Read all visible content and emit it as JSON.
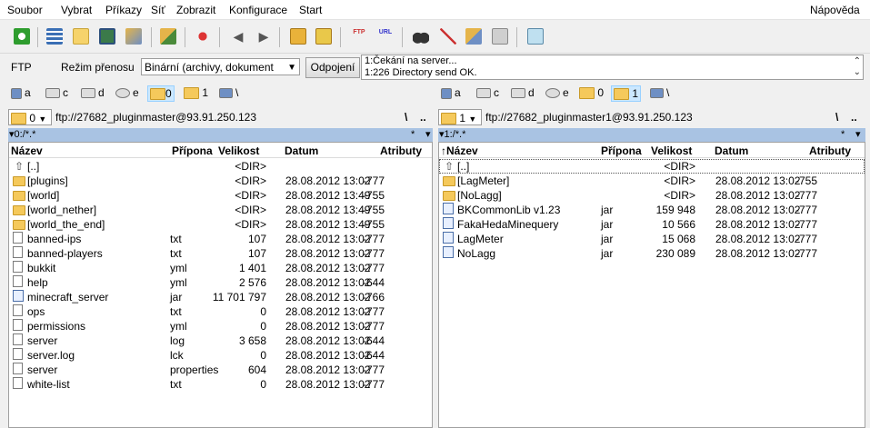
{
  "menu": {
    "items": [
      "Soubor",
      "Vybrat",
      "Příkazy",
      "Síť",
      "Zobrazit",
      "Konfigurace",
      "Start"
    ],
    "help": "Nápověda"
  },
  "ftpbar": {
    "ftp_label": "FTP",
    "mode_label": "Režim přenosu",
    "mode_value": "Binární (archivy, dokument",
    "disconnect_label": "Odpojení",
    "log_lines": [
      "1:Čekání na server...",
      "1:226 Directory send OK."
    ]
  },
  "left": {
    "drives": [
      "a",
      "c",
      "d",
      "e",
      "0",
      "1",
      "\\"
    ],
    "path_combo": "0",
    "path": "ftp://27682_pluginmaster@93.91.250.123",
    "filter": "▾0:/*.*",
    "nav_back": "\\",
    "nav_up": "..",
    "star": "*",
    "filter_arrow": "▾",
    "headers": {
      "name": "Název",
      "ext": "Přípona",
      "size": "Velikost",
      "date": "Datum",
      "attr": "Atributy"
    },
    "rows": [
      {
        "icon": "up",
        "name": "[..]",
        "ext": "",
        "size": "<DIR>",
        "date": "",
        "attr": ""
      },
      {
        "icon": "folder",
        "name": "[plugins]",
        "ext": "",
        "size": "<DIR>",
        "date": "28.08.2012 13:02",
        "attr": "-777"
      },
      {
        "icon": "folder",
        "name": "[world]",
        "ext": "",
        "size": "<DIR>",
        "date": "28.08.2012 13:49",
        "attr": "-755"
      },
      {
        "icon": "folder",
        "name": "[world_nether]",
        "ext": "",
        "size": "<DIR>",
        "date": "28.08.2012 13:49",
        "attr": "-755"
      },
      {
        "icon": "folder",
        "name": "[world_the_end]",
        "ext": "",
        "size": "<DIR>",
        "date": "28.08.2012 13:49",
        "attr": "-755"
      },
      {
        "icon": "file",
        "name": "banned-ips",
        "ext": "txt",
        "size": "107",
        "date": "28.08.2012 13:02",
        "attr": "-777"
      },
      {
        "icon": "file",
        "name": "banned-players",
        "ext": "txt",
        "size": "107",
        "date": "28.08.2012 13:02",
        "attr": "-777"
      },
      {
        "icon": "file",
        "name": "bukkit",
        "ext": "yml",
        "size": "1 401",
        "date": "28.08.2012 13:02",
        "attr": "-777"
      },
      {
        "icon": "file",
        "name": "help",
        "ext": "yml",
        "size": "2 576",
        "date": "28.08.2012 13:02",
        "attr": "-644"
      },
      {
        "icon": "jar",
        "name": "minecraft_server",
        "ext": "jar",
        "size": "11 701 797",
        "date": "28.08.2012 13:02",
        "attr": "-766"
      },
      {
        "icon": "file",
        "name": "ops",
        "ext": "txt",
        "size": "0",
        "date": "28.08.2012 13:02",
        "attr": "-777"
      },
      {
        "icon": "file",
        "name": "permissions",
        "ext": "yml",
        "size": "0",
        "date": "28.08.2012 13:02",
        "attr": "-777"
      },
      {
        "icon": "file",
        "name": "server",
        "ext": "log",
        "size": "3 658",
        "date": "28.08.2012 13:02",
        "attr": "-644"
      },
      {
        "icon": "file",
        "name": "server.log",
        "ext": "lck",
        "size": "0",
        "date": "28.08.2012 13:02",
        "attr": "-644"
      },
      {
        "icon": "file",
        "name": "server",
        "ext": "properties",
        "size": "604",
        "date": "28.08.2012 13:02",
        "attr": "-777"
      },
      {
        "icon": "file",
        "name": "white-list",
        "ext": "txt",
        "size": "0",
        "date": "28.08.2012 13:02",
        "attr": "-777"
      }
    ]
  },
  "right": {
    "drives": [
      "a",
      "c",
      "d",
      "e",
      "0",
      "1",
      "\\"
    ],
    "path_combo": "1",
    "path": "ftp://27682_pluginmaster1@93.91.250.123",
    "filter": "▾1:/*.*",
    "nav_back": "\\",
    "nav_up": "..",
    "star": "*",
    "filter_arrow": "▾",
    "headers": {
      "name": "↑Název",
      "ext": "Přípona",
      "size": "Velikost",
      "date": "Datum",
      "attr": "Atributy"
    },
    "rows": [
      {
        "icon": "up",
        "name": "[..]",
        "ext": "",
        "size": "<DIR>",
        "date": "",
        "attr": ""
      },
      {
        "icon": "folder",
        "name": "[LagMeter]",
        "ext": "",
        "size": "<DIR>",
        "date": "28.08.2012 13:02",
        "attr": "-755"
      },
      {
        "icon": "folder",
        "name": "[NoLagg]",
        "ext": "",
        "size": "<DIR>",
        "date": "28.08.2012 13:02",
        "attr": "-777"
      },
      {
        "icon": "jar",
        "name": "BKCommonLib v1.23",
        "ext": "jar",
        "size": "159 948",
        "date": "28.08.2012 13:02",
        "attr": "-777"
      },
      {
        "icon": "jar",
        "name": "FakaHedaMinequery",
        "ext": "jar",
        "size": "10 566",
        "date": "28.08.2012 13:02",
        "attr": "-777"
      },
      {
        "icon": "jar",
        "name": "LagMeter",
        "ext": "jar",
        "size": "15 068",
        "date": "28.08.2012 13:02",
        "attr": "-777"
      },
      {
        "icon": "jar",
        "name": "NoLagg",
        "ext": "jar",
        "size": "230 089",
        "date": "28.08.2012 13:02",
        "attr": "-777"
      }
    ]
  },
  "colors": {
    "filterbar": "#a9c3e3",
    "selected": "#cce8ff",
    "folder": "#f5c95b"
  },
  "toolbar_icons": [
    "refresh-icon",
    "brief-view-icon",
    "detailed-view-icon",
    "thumbnail-view-icon",
    "tree-view-icon",
    "invert-selection-icon",
    "compare-icon",
    "back-icon",
    "forward-icon",
    "pack-icon",
    "unpack-icon",
    "ftp-connect-icon",
    "url-icon",
    "search-icon",
    "rename-multi-icon",
    "sync-dirs-icon",
    "copy-queue-icon",
    "notepad-icon"
  ]
}
